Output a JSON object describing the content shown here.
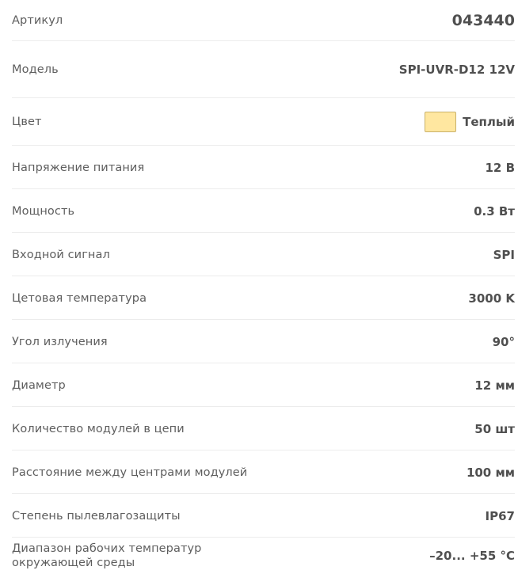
{
  "specs": [
    {
      "label": "Артикул",
      "value": "043440"
    },
    {
      "label": "Модель",
      "value": "SPI-UVR-D12 12V"
    },
    {
      "label": "Цвет",
      "value": "Теплый",
      "swatch_color": "#FFE7A0"
    },
    {
      "label": "Напряжение питания",
      "value": "12 В"
    },
    {
      "label": "Мощность",
      "value": "0.3 Вт"
    },
    {
      "label": "Входной сигнал",
      "value": "SPI"
    },
    {
      "label": "Цетовая температура",
      "value": "3000 K"
    },
    {
      "label": "Угол излучения",
      "value": "90°"
    },
    {
      "label": "Диаметр",
      "value": "12 мм"
    },
    {
      "label": "Количество модулей в цепи",
      "value": "50 шт"
    },
    {
      "label": "Расстояние между центрами модулей",
      "value": "100 мм"
    },
    {
      "label": "Степень пылевлагозащиты",
      "value": "IP67"
    },
    {
      "label": "Диапазон рабочих температур окружающей среды",
      "value": "–20... +55 °C"
    }
  ]
}
